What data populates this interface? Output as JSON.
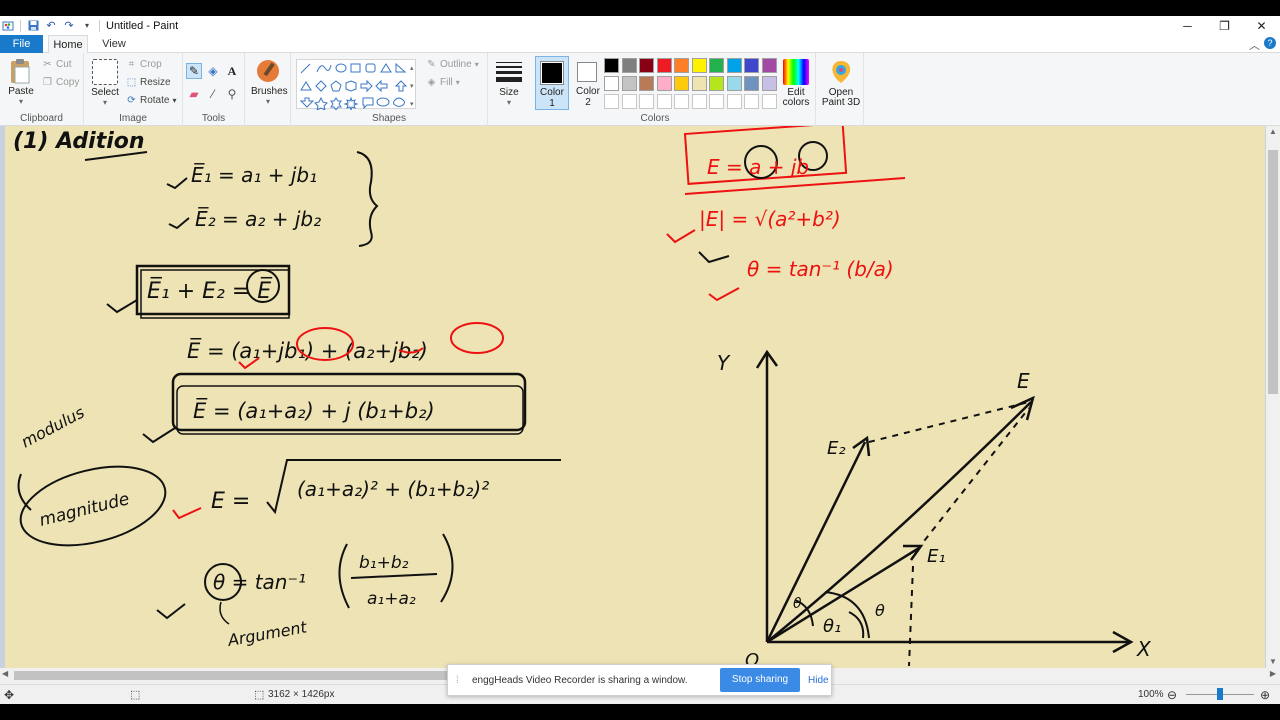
{
  "window": {
    "title": "Untitled - Paint",
    "controls": [
      "minimize",
      "restore",
      "close"
    ]
  },
  "tabs": [
    "File",
    "Home",
    "View"
  ],
  "ribbon": {
    "clipboard": {
      "label": "Clipboard",
      "paste": "Paste",
      "cut": "Cut",
      "copy": "Copy"
    },
    "image": {
      "label": "Image",
      "select": "Select",
      "crop": "Crop",
      "resize": "Resize",
      "rotate": "Rotate"
    },
    "tools": {
      "label": "Tools"
    },
    "brushes": {
      "label": "Brushes"
    },
    "shapes": {
      "label": "Shapes",
      "outline": "Outline",
      "fill": "Fill"
    },
    "size": {
      "label": "Size"
    },
    "colors": {
      "label": "Colors",
      "color1": "Color 1",
      "color1_line1": "Color",
      "color1_line2": "1",
      "color2_line1": "Color",
      "color2_line2": "2",
      "edit_line1": "Edit",
      "edit_line2": "colors",
      "color1_value": "#000000",
      "color2_value": "#ffffff",
      "palette_row1": [
        "#000000",
        "#7f7f7f",
        "#880015",
        "#ed1c24",
        "#ff7f27",
        "#fff200",
        "#22b14c",
        "#00a2e8",
        "#3f48cc",
        "#a349a4"
      ],
      "palette_row2": [
        "#ffffff",
        "#c3c3c3",
        "#b97a57",
        "#ffaec9",
        "#ffc90e",
        "#efe4b0",
        "#b5e61d",
        "#99d9ea",
        "#7092be",
        "#c8bfe7"
      ]
    },
    "paint3d": {
      "line1": "Open",
      "line2": "Paint 3D"
    }
  },
  "canvas": {
    "background": "#ede3b4",
    "notes": {
      "heading": "(1) Adition",
      "e1": "E̅₁ = a₁ + jb₁",
      "e2": "E̅₂ = a₂ + jb₂",
      "sum": "E̅₁ + E₂ = E̅",
      "expanded": "E̅ = (a₁+jb₁) + (a₂+jb₂)",
      "grouped": "E̅ = (a₁+a₂) + j (b₁+b₂)",
      "modulus": "modulus",
      "magnitude": "magnitude",
      "mag_formula_lhs": "E =",
      "mag_formula_rhs": "(a₁+a₂)² + (b₁+b₂)²",
      "theta_lhs": "θ = tan⁻¹",
      "theta_num": "b₁+b₂",
      "theta_den": "a₁+a₂",
      "argument": "Argument",
      "polar_box": "E = a + jb",
      "polar_mag": "|E| = √(a²+b²)",
      "polar_theta": "θ = tan⁻¹ (b/a)",
      "axis_y": "Y",
      "axis_x": "X",
      "origin": "O",
      "vec_e": "E",
      "vec_e1": "E₁",
      "vec_e2": "E₂",
      "ang_theta": "θ",
      "ang_theta1": "θ₁",
      "ang_theta2": "θ"
    }
  },
  "status": {
    "dimensions": "3162 × 1426px",
    "zoom": "100%",
    "zoom_level_percent": 100
  },
  "share_bar": {
    "message": "enggHeads Video Recorder is sharing a window.",
    "stop": "Stop sharing",
    "hide": "Hide"
  }
}
